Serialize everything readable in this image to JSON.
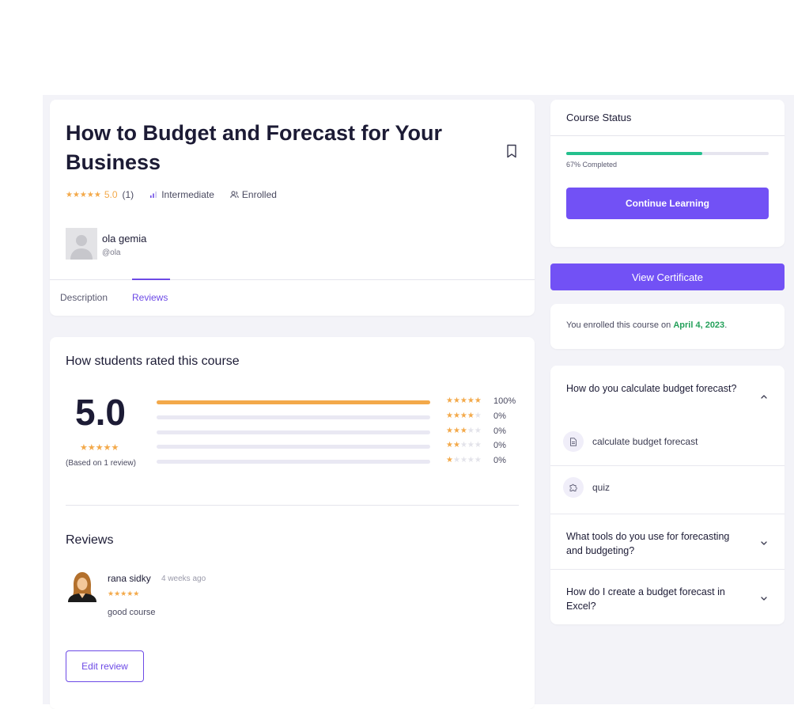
{
  "course": {
    "title": "How to Budget and Forecast for Your Business",
    "rating_stars": "★★★★★",
    "rating_value": "5.0",
    "rating_count": "(1)",
    "level": "Intermediate",
    "enrollment_status": "Enrolled",
    "author_name": "ola gemia",
    "author_handle": "@ola"
  },
  "tabs": [
    {
      "label": "Description",
      "active": false
    },
    {
      "label": "Reviews",
      "active": true
    }
  ],
  "ratings": {
    "heading": "How students rated this course",
    "average": "5.0",
    "average_stars": "★★★★★",
    "based_on": "(Based on 1 review)",
    "breakdown": [
      {
        "stars": 5,
        "percent_label": "100%",
        "fraction": 1.0
      },
      {
        "stars": 4,
        "percent_label": "0%",
        "fraction": 0
      },
      {
        "stars": 3,
        "percent_label": "0%",
        "fraction": 0
      },
      {
        "stars": 2,
        "percent_label": "0%",
        "fraction": 0
      },
      {
        "stars": 1,
        "percent_label": "0%",
        "fraction": 0
      }
    ]
  },
  "reviews": {
    "heading": "Reviews",
    "items": [
      {
        "name": "rana sidky",
        "time": "4 weeks ago",
        "stars": "★★★★★",
        "text": "good course"
      }
    ],
    "edit_label": "Edit review"
  },
  "status": {
    "title": "Course Status",
    "progress_fraction": 0.67,
    "progress_label": "67% Completed",
    "continue_label": "Continue Learning",
    "certificate_label": "View Certificate",
    "enrolled_prefix": "You enrolled this course on ",
    "enrolled_date": "April 4, 2023",
    "enrolled_suffix": "."
  },
  "faq": {
    "q1": "How do you calculate budget forecast?",
    "q1_items": [
      "calculate budget forecast",
      "quiz"
    ],
    "q2": "What tools do you use for forecasting and budgeting?",
    "q3": "How do I create a budget forecast in Excel?"
  },
  "colors": {
    "accent": "#7251f5",
    "star": "#f3a94a",
    "progress": "#24c08d",
    "date": "#24a05a"
  }
}
